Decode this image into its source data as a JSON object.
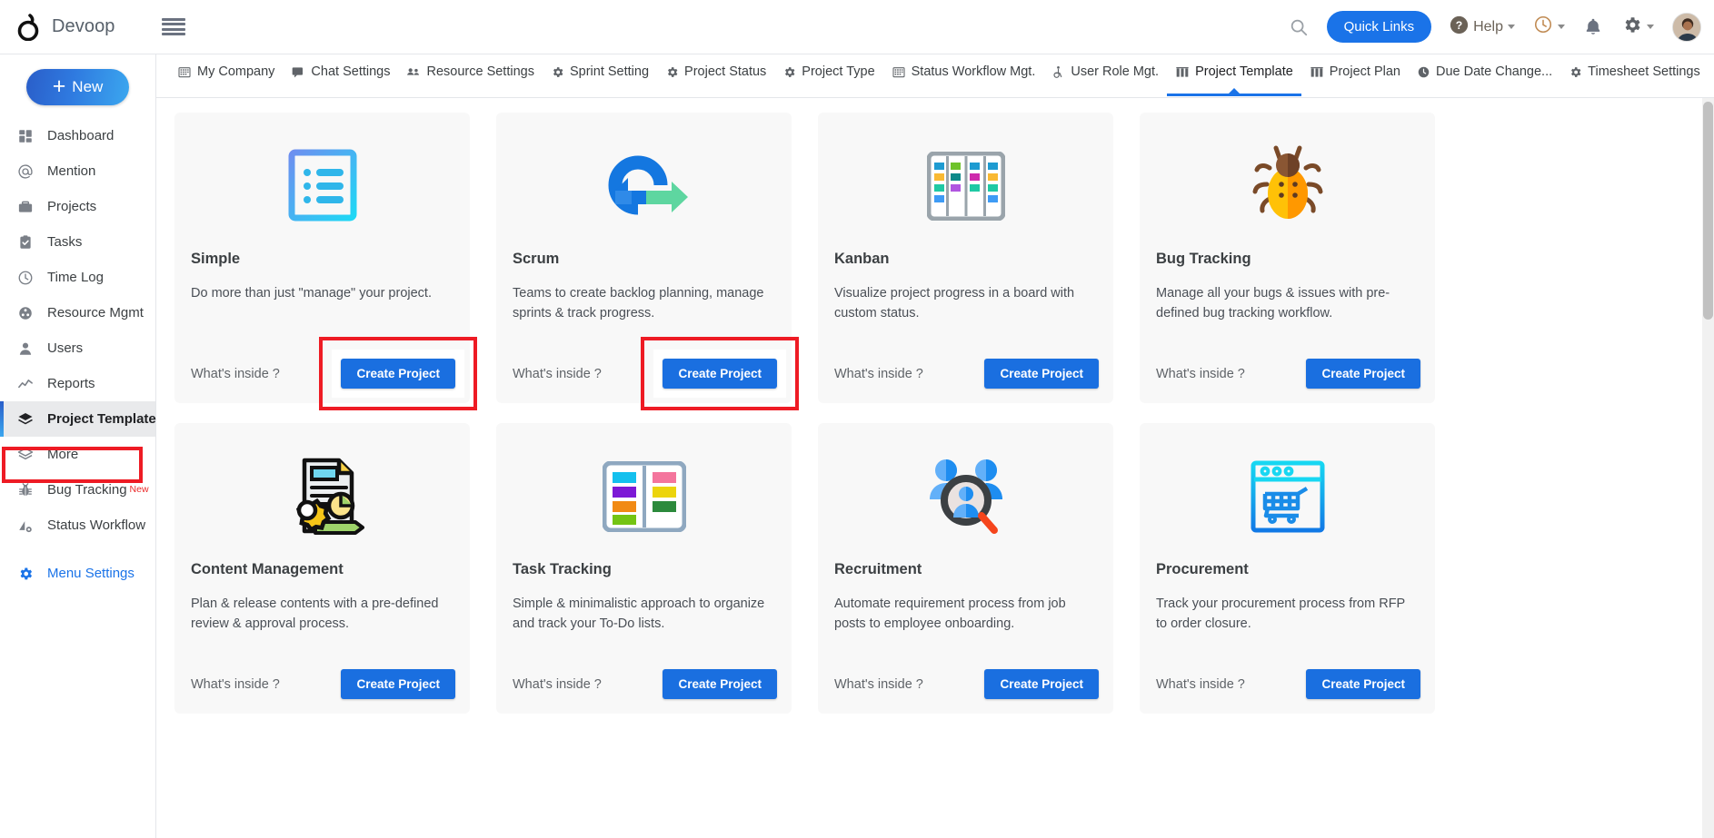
{
  "header": {
    "brand_name": "Devoop",
    "menu_icon": "hamburger-icon",
    "search_icon": "search-icon",
    "quick_links_label": "Quick Links",
    "help_label": "Help",
    "help_icon": "question-circle-icon",
    "time_icon": "clock-icon",
    "notification_icon": "bell-icon",
    "settings_icon": "gear-icon",
    "avatar_icon": "user-avatar"
  },
  "sidebar": {
    "new_button_label": "New",
    "items": [
      {
        "label": "Dashboard",
        "icon": "dashboard-icon",
        "active": false,
        "badge": ""
      },
      {
        "label": "Mention",
        "icon": "at-icon",
        "active": false,
        "badge": ""
      },
      {
        "label": "Projects",
        "icon": "briefcase-icon",
        "active": false,
        "badge": ""
      },
      {
        "label": "Tasks",
        "icon": "clipboard-check-icon",
        "active": false,
        "badge": ""
      },
      {
        "label": "Time Log",
        "icon": "clock-icon",
        "active": false,
        "badge": ""
      },
      {
        "label": "Resource Mgmt",
        "icon": "resource-icon",
        "active": false,
        "badge": ""
      },
      {
        "label": "Users",
        "icon": "user-icon",
        "active": false,
        "badge": ""
      },
      {
        "label": "Reports",
        "icon": "chart-line-icon",
        "active": false,
        "badge": ""
      },
      {
        "label": "Project Template",
        "icon": "layers-icon",
        "active": true,
        "badge": ""
      },
      {
        "label": "More",
        "icon": "layers-outline-icon",
        "active": false,
        "badge": ""
      },
      {
        "label": "Bug Tracking",
        "icon": "bug-icon",
        "active": false,
        "badge": "New"
      },
      {
        "label": "Status Workflow",
        "icon": "workflow-gear-icon",
        "active": false,
        "badge": ""
      }
    ],
    "menu_settings_label": "Menu Settings",
    "menu_settings_icon": "gear-icon"
  },
  "tabs": [
    {
      "label": "My Company",
      "icon": "building-icon",
      "active": false
    },
    {
      "label": "Chat Settings",
      "icon": "chat-gear-icon",
      "active": false
    },
    {
      "label": "Resource Settings",
      "icon": "people-gear-icon",
      "active": false
    },
    {
      "label": "Sprint Setting",
      "icon": "gear-icon",
      "active": false
    },
    {
      "label": "Project Status",
      "icon": "gear-icon",
      "active": false
    },
    {
      "label": "Project Type",
      "icon": "gear-icon",
      "active": false
    },
    {
      "label": "Status Workflow Mgt.",
      "icon": "building-icon",
      "active": false
    },
    {
      "label": "User Role Mgt.",
      "icon": "accessibility-icon",
      "active": false
    },
    {
      "label": "Project Template",
      "icon": "columns-icon",
      "active": true
    },
    {
      "label": "Project Plan",
      "icon": "columns-icon",
      "active": false
    },
    {
      "label": "Due Date Change...",
      "icon": "clock-filled-icon",
      "active": false
    },
    {
      "label": "Timesheet Settings",
      "icon": "gear-icon",
      "active": false
    }
  ],
  "templates": [
    {
      "title": "Simple",
      "description": "Do more than just \"manage\" your project.",
      "icon": "checklist-icon",
      "whats_inside_label": "What's inside ?",
      "create_label": "Create Project",
      "annotated": true
    },
    {
      "title": "Scrum",
      "description": "Teams to create backlog planning, manage sprints & track progress.",
      "icon": "scrum-cycle-icon",
      "whats_inside_label": "What's inside ?",
      "create_label": "Create Project",
      "annotated": true
    },
    {
      "title": "Kanban",
      "description": "Visualize project progress in a board with custom status.",
      "icon": "kanban-board-icon",
      "whats_inside_label": "What's inside ?",
      "create_label": "Create Project",
      "annotated": false
    },
    {
      "title": "Bug Tracking",
      "description": "Manage all your bugs & issues with pre-defined bug tracking workflow.",
      "icon": "ladybug-icon",
      "whats_inside_label": "What's inside ?",
      "create_label": "Create Project",
      "annotated": false
    },
    {
      "title": "Content Management",
      "description": "Plan & release contents with a pre-defined review & approval process.",
      "icon": "document-gear-icon",
      "whats_inside_label": "What's inside ?",
      "create_label": "Create Project",
      "annotated": false
    },
    {
      "title": "Task Tracking",
      "description": "Simple & minimalistic approach to organize and track your To-Do lists.",
      "icon": "two-column-board-icon",
      "whats_inside_label": "What's inside ?",
      "create_label": "Create Project",
      "annotated": false
    },
    {
      "title": "Recruitment",
      "description": "Automate requirement process from job posts to employee onboarding.",
      "icon": "people-search-icon",
      "whats_inside_label": "What's inside ?",
      "create_label": "Create Project",
      "annotated": false
    },
    {
      "title": "Procurement",
      "description": "Track your procurement process from RFP to order closure.",
      "icon": "shopping-cart-window-icon",
      "whats_inside_label": "What's inside ?",
      "create_label": "Create Project",
      "annotated": false
    }
  ],
  "colors": {
    "accent_blue": "#1a73e8",
    "button_blue": "#1a6fe0",
    "annotation_red": "#ee1b24",
    "card_bg": "#f8f8f8",
    "badge_red": "#ea2a2a"
  }
}
